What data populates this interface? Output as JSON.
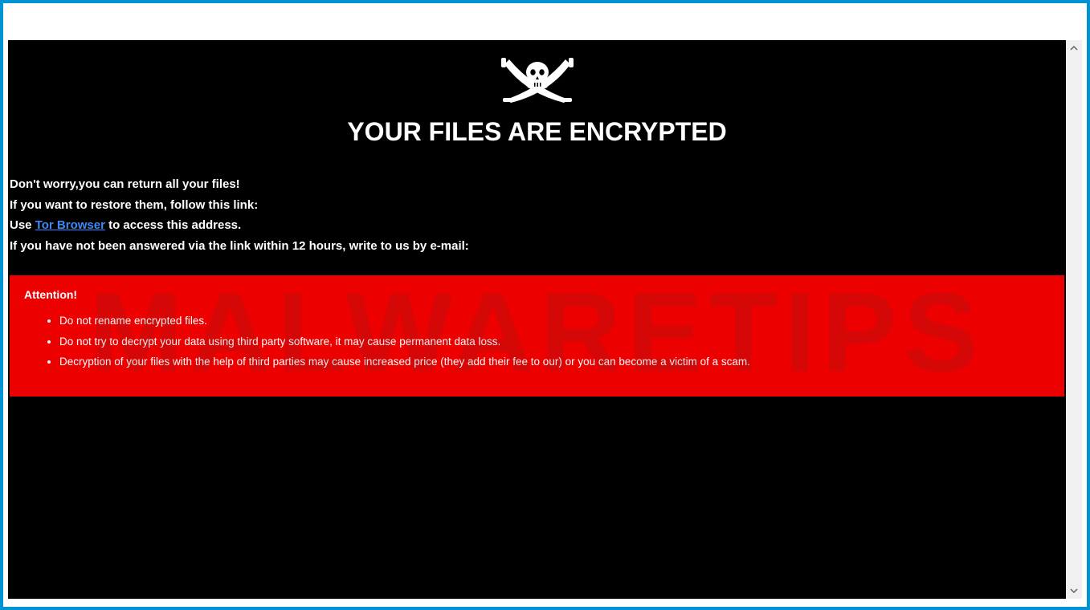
{
  "headline": "YOUR FILES ARE ENCRYPTED",
  "body": {
    "line1": "Don't worry,you can return all your files!",
    "line2": "If you want to restore them, follow this link:",
    "line3_prefix": "Use ",
    "line3_link": "Tor Browser",
    "line3_suffix": " to access this address.",
    "line4": "If you have not been answered via the link within 12 hours, write to us by e-mail:"
  },
  "attention": {
    "title": "Attention!",
    "items": [
      "Do not rename encrypted files.",
      "Do not try to decrypt your data using third party software, it may cause permanent data loss.",
      "Decryption of your files with the help of third parties may cause increased price (they add their fee to our) or you can become a victim of a scam."
    ]
  },
  "watermark": "MALWARETIPS"
}
